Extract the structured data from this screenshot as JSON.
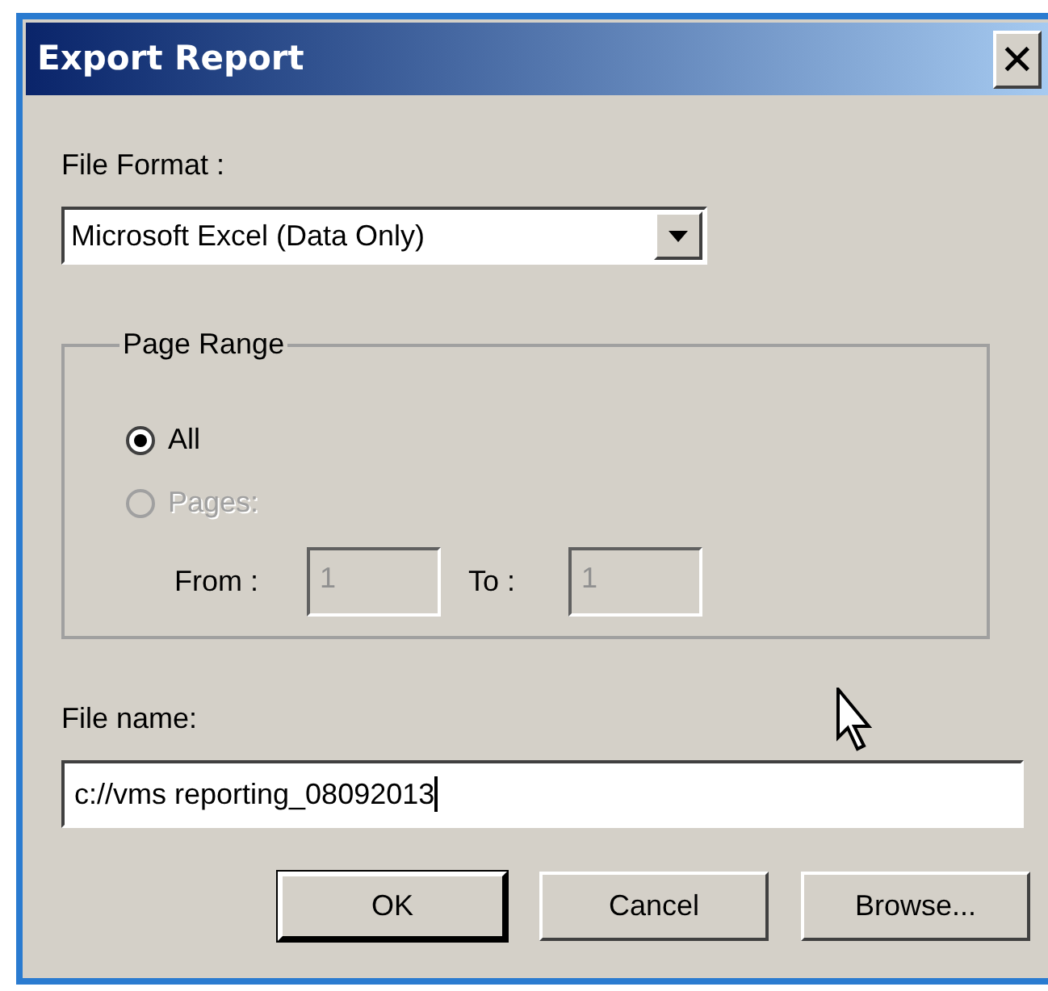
{
  "window": {
    "title": "Export Report",
    "close": "✕"
  },
  "file_format": {
    "label": "File Format :",
    "value": "Microsoft Excel (Data Only)"
  },
  "page_range": {
    "legend": "Page Range",
    "options": [
      {
        "label": "All",
        "selected": true,
        "disabled": false
      },
      {
        "label": "Pages:",
        "selected": false,
        "disabled": true
      }
    ],
    "from": {
      "label": "From :",
      "value": "1",
      "disabled": true
    },
    "to": {
      "label": "To :",
      "value": "1",
      "disabled": true
    }
  },
  "file_name": {
    "label": "File name:",
    "value": "c://vms reporting_08092013",
    "focused": true
  },
  "buttons": [
    {
      "label": "OK",
      "default": true
    },
    {
      "label": "Cancel",
      "default": false
    },
    {
      "label": "Browse...",
      "default": false
    }
  ]
}
